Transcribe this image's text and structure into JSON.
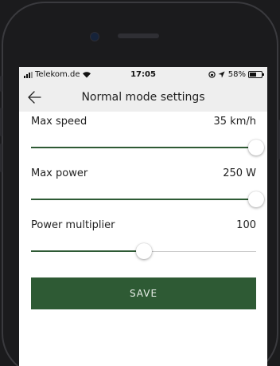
{
  "status_bar": {
    "carrier": "Telekom.de",
    "time": "17:05",
    "battery_text": "58%",
    "battery_level": 0.58
  },
  "nav": {
    "title": "Normal mode settings",
    "back_icon": "arrow-left-icon"
  },
  "settings": [
    {
      "label": "Max speed",
      "value": "35 km/h",
      "slider_fraction": 1.0
    },
    {
      "label": "Max power",
      "value": "250 W",
      "slider_fraction": 1.0
    },
    {
      "label": "Power multiplier",
      "value": "100",
      "slider_fraction": 0.5
    }
  ],
  "save_label": "SAVE",
  "colors": {
    "accent": "#2e5a34",
    "bar_background": "#eeeeee"
  }
}
